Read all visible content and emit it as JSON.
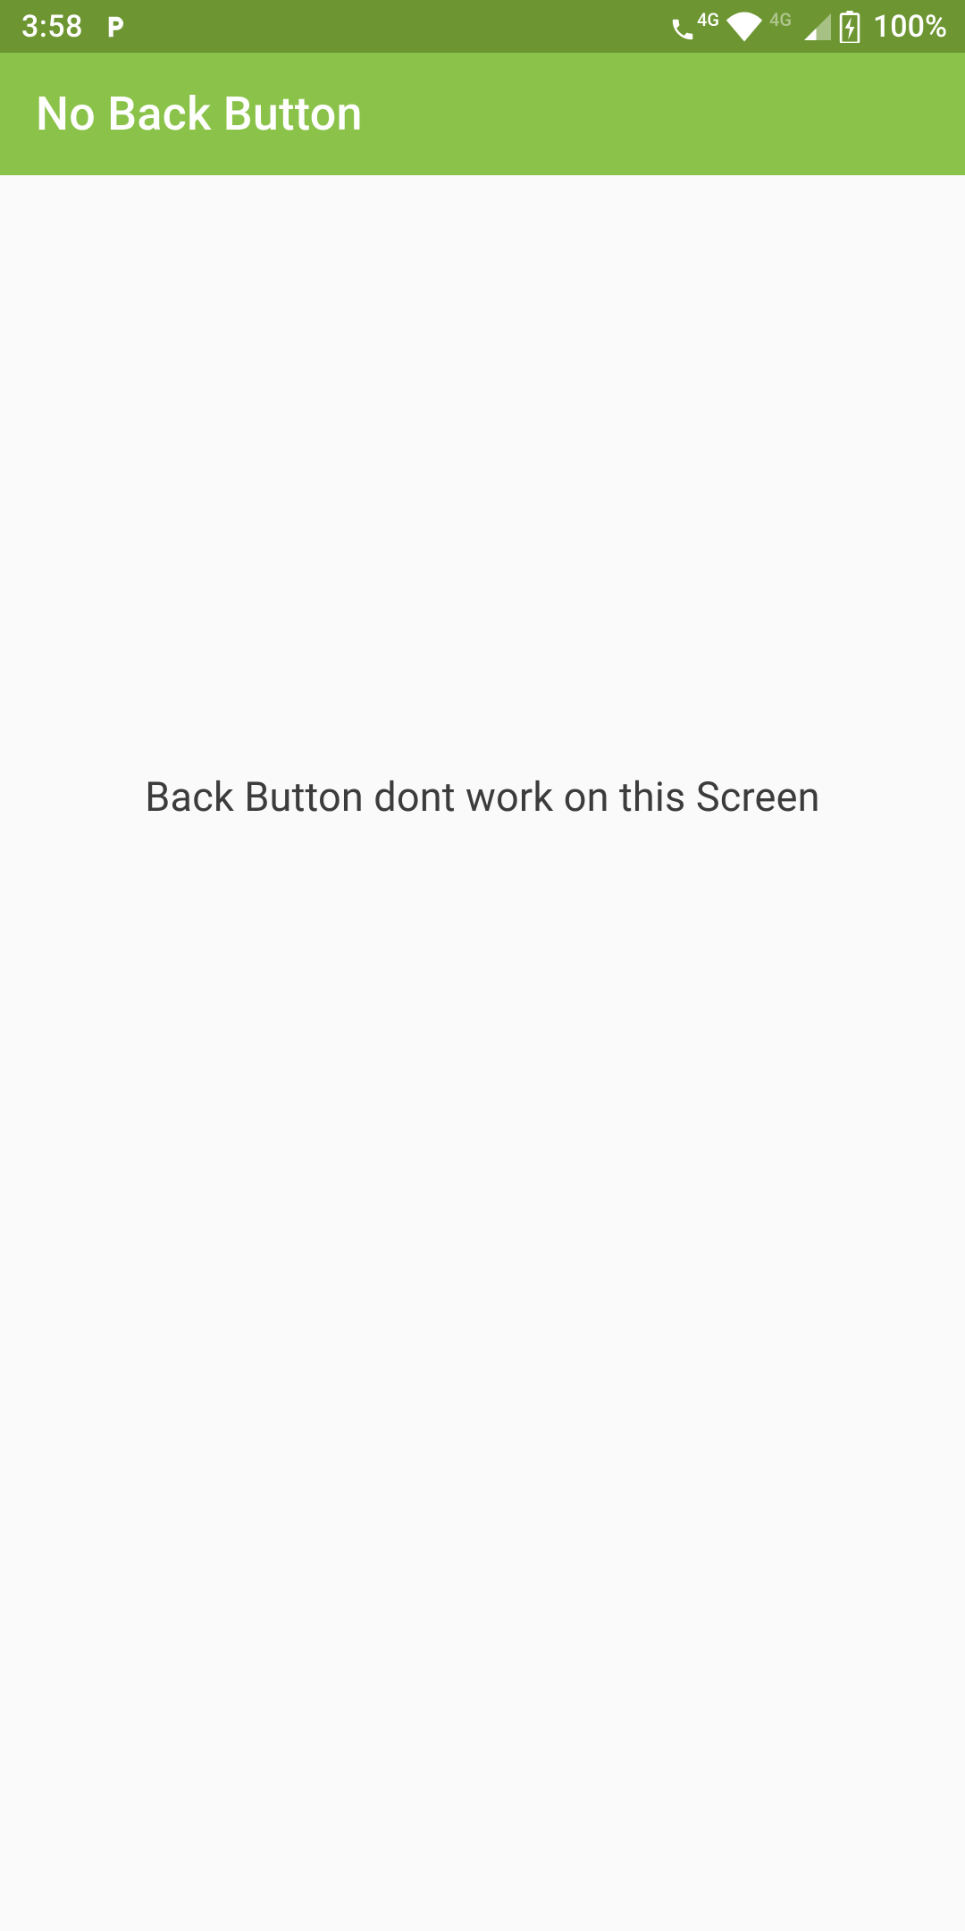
{
  "status_bar": {
    "time": "3:58",
    "battery_pct": "100%",
    "network_label_1": "4G",
    "network_label_2": "4G"
  },
  "app_bar": {
    "title": "No Back Button"
  },
  "content": {
    "message": "Back Button dont work on this Screen"
  }
}
